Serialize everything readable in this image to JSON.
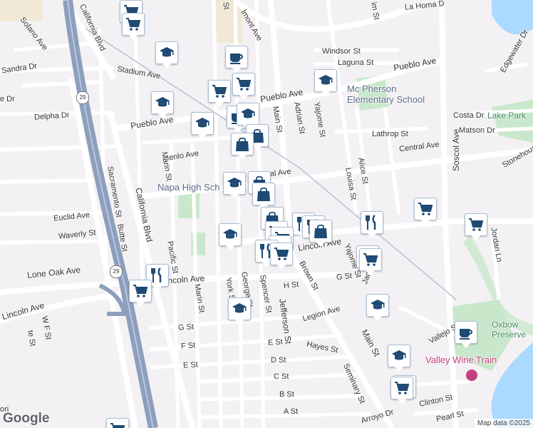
{
  "map": {
    "streets": {
      "solano_ave": "Solano Ave",
      "california_blvd_n": "California Blvd",
      "sandra_dr": "Sandra Dr",
      "stadium_ave": "Stadium Ave",
      "delpha_dr": "Delpha Dr",
      "pueblo_ave_w": "Pueblo Ave",
      "pueblo_ave_c": "Pueblo Ave",
      "pueblo_ave_e": "Pueblo Ave",
      "menlo_ave": "Menlo Ave",
      "marin_st_n": "Marin St",
      "central_ave_w": "Central Ave",
      "central_ave_e": "Central Ave",
      "sacramento_st": "Sacramento St",
      "california_blvd_c": "California Blvd",
      "euclid_ave": "Euclid Ave",
      "waverly_st": "Waverly St",
      "butte_st": "Butte St",
      "pacific_st": "Pacific St",
      "lone_oak_ave": "Lone Oak Ave",
      "lincoln_ave_w": "Lincoln Ave",
      "lincoln_ave_c": "Lincoln Ave",
      "lincoln_ave_sw": "Lincoln Ave",
      "wf_st": "W F St",
      "marin_st_s": "Marin St",
      "york_st": "York St",
      "george_st": "George St",
      "spencer_st": "Spencer St",
      "h_st": "H St",
      "g_st_w": "G St",
      "g_st_e": "G St",
      "f_st": "F St",
      "e_st_w": "E St",
      "e_st_c": "E St",
      "d_st": "D St",
      "c_st": "C St",
      "b_st": "B St",
      "a_st": "A St",
      "jefferson_st": "Jefferson St",
      "legion_ave": "Legion Ave",
      "hayes_st": "Hayes St",
      "brown_st": "Brown St",
      "main_st_n": "Main St",
      "main_st_s": "Main St",
      "adrian_st": "Adrian St",
      "yajome_st_n": "Yajome St",
      "yajome_st_s": "Yajome St",
      "jackson_st": "Jackson St",
      "seminary_st": "Seminary St",
      "arroyo_dr": "Arroyo Dr",
      "clinton_st": "Clinton St",
      "pearl_st": "Pearl St",
      "vallejo_st": "Vallejo St",
      "windsor_st": "Windsor St",
      "laguna_st": "Laguna St",
      "lathrop_st": "Lathrop St",
      "alice_st": "Alice St",
      "louisa_st": "Louisa St",
      "soscol_ave": "Soscol Ave",
      "jordan_ln": "Jordan Ln",
      "costa_dr": "Costa Dr",
      "matson_dr": "Matson Dr",
      "edgewater_dr": "Edgewater Dr",
      "stonehouse": "Stonehouse",
      "la_homa_dr": "La Homa D",
      "belmont_ave": "lmont Ave",
      "st_top": "St",
      "im_st": "im St",
      "e_dr": "e Dr",
      "te_st": "te St",
      "ori": "ori"
    },
    "pois": {
      "napa_high_school": "Napa High Sch",
      "mcpherson_school_line1": "Mc Pherson",
      "mcpherson_school_line2": "Elementary School",
      "lake_park": "Lake Park",
      "oxbow_line1": "Oxbow",
      "oxbow_line2": "Preserve",
      "valley_wine_train": "Valley Wine Train"
    },
    "highway_shields": [
      "29",
      "29"
    ],
    "marker_types": [
      "school-icon",
      "shopping-cart-icon",
      "coffee-icon",
      "shopping-bag-icon",
      "restaurant-icon"
    ],
    "colors": {
      "background": "#f4f1f4",
      "road": "#ffffff",
      "highway": "#8e9fbd",
      "park": "#c9e8cb",
      "water": "#aadaff",
      "marker_border": "#a9bfd3",
      "marker_icon": "#1e4a73"
    }
  },
  "attribution": {
    "logo": "Google",
    "credit": "Map data ©2025"
  }
}
